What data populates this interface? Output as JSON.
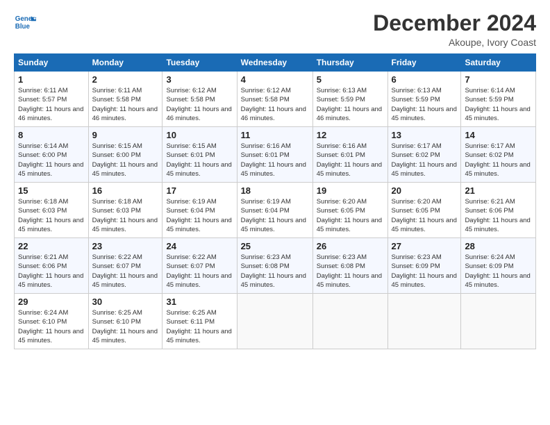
{
  "logo": {
    "line1": "General",
    "line2": "Blue"
  },
  "title": "December 2024",
  "subtitle": "Akoupe, Ivory Coast",
  "days_of_week": [
    "Sunday",
    "Monday",
    "Tuesday",
    "Wednesday",
    "Thursday",
    "Friday",
    "Saturday"
  ],
  "weeks": [
    [
      {
        "day": "1",
        "sunrise": "6:11 AM",
        "sunset": "5:57 PM",
        "daylight": "11 hours and 46 minutes."
      },
      {
        "day": "2",
        "sunrise": "6:11 AM",
        "sunset": "5:58 PM",
        "daylight": "11 hours and 46 minutes."
      },
      {
        "day": "3",
        "sunrise": "6:12 AM",
        "sunset": "5:58 PM",
        "daylight": "11 hours and 46 minutes."
      },
      {
        "day": "4",
        "sunrise": "6:12 AM",
        "sunset": "5:58 PM",
        "daylight": "11 hours and 46 minutes."
      },
      {
        "day": "5",
        "sunrise": "6:13 AM",
        "sunset": "5:59 PM",
        "daylight": "11 hours and 46 minutes."
      },
      {
        "day": "6",
        "sunrise": "6:13 AM",
        "sunset": "5:59 PM",
        "daylight": "11 hours and 45 minutes."
      },
      {
        "day": "7",
        "sunrise": "6:14 AM",
        "sunset": "5:59 PM",
        "daylight": "11 hours and 45 minutes."
      }
    ],
    [
      {
        "day": "8",
        "sunrise": "6:14 AM",
        "sunset": "6:00 PM",
        "daylight": "11 hours and 45 minutes."
      },
      {
        "day": "9",
        "sunrise": "6:15 AM",
        "sunset": "6:00 PM",
        "daylight": "11 hours and 45 minutes."
      },
      {
        "day": "10",
        "sunrise": "6:15 AM",
        "sunset": "6:01 PM",
        "daylight": "11 hours and 45 minutes."
      },
      {
        "day": "11",
        "sunrise": "6:16 AM",
        "sunset": "6:01 PM",
        "daylight": "11 hours and 45 minutes."
      },
      {
        "day": "12",
        "sunrise": "6:16 AM",
        "sunset": "6:01 PM",
        "daylight": "11 hours and 45 minutes."
      },
      {
        "day": "13",
        "sunrise": "6:17 AM",
        "sunset": "6:02 PM",
        "daylight": "11 hours and 45 minutes."
      },
      {
        "day": "14",
        "sunrise": "6:17 AM",
        "sunset": "6:02 PM",
        "daylight": "11 hours and 45 minutes."
      }
    ],
    [
      {
        "day": "15",
        "sunrise": "6:18 AM",
        "sunset": "6:03 PM",
        "daylight": "11 hours and 45 minutes."
      },
      {
        "day": "16",
        "sunrise": "6:18 AM",
        "sunset": "6:03 PM",
        "daylight": "11 hours and 45 minutes."
      },
      {
        "day": "17",
        "sunrise": "6:19 AM",
        "sunset": "6:04 PM",
        "daylight": "11 hours and 45 minutes."
      },
      {
        "day": "18",
        "sunrise": "6:19 AM",
        "sunset": "6:04 PM",
        "daylight": "11 hours and 45 minutes."
      },
      {
        "day": "19",
        "sunrise": "6:20 AM",
        "sunset": "6:05 PM",
        "daylight": "11 hours and 45 minutes."
      },
      {
        "day": "20",
        "sunrise": "6:20 AM",
        "sunset": "6:05 PM",
        "daylight": "11 hours and 45 minutes."
      },
      {
        "day": "21",
        "sunrise": "6:21 AM",
        "sunset": "6:06 PM",
        "daylight": "11 hours and 45 minutes."
      }
    ],
    [
      {
        "day": "22",
        "sunrise": "6:21 AM",
        "sunset": "6:06 PM",
        "daylight": "11 hours and 45 minutes."
      },
      {
        "day": "23",
        "sunrise": "6:22 AM",
        "sunset": "6:07 PM",
        "daylight": "11 hours and 45 minutes."
      },
      {
        "day": "24",
        "sunrise": "6:22 AM",
        "sunset": "6:07 PM",
        "daylight": "11 hours and 45 minutes."
      },
      {
        "day": "25",
        "sunrise": "6:23 AM",
        "sunset": "6:08 PM",
        "daylight": "11 hours and 45 minutes."
      },
      {
        "day": "26",
        "sunrise": "6:23 AM",
        "sunset": "6:08 PM",
        "daylight": "11 hours and 45 minutes."
      },
      {
        "day": "27",
        "sunrise": "6:23 AM",
        "sunset": "6:09 PM",
        "daylight": "11 hours and 45 minutes."
      },
      {
        "day": "28",
        "sunrise": "6:24 AM",
        "sunset": "6:09 PM",
        "daylight": "11 hours and 45 minutes."
      }
    ],
    [
      {
        "day": "29",
        "sunrise": "6:24 AM",
        "sunset": "6:10 PM",
        "daylight": "11 hours and 45 minutes."
      },
      {
        "day": "30",
        "sunrise": "6:25 AM",
        "sunset": "6:10 PM",
        "daylight": "11 hours and 45 minutes."
      },
      {
        "day": "31",
        "sunrise": "6:25 AM",
        "sunset": "6:11 PM",
        "daylight": "11 hours and 45 minutes."
      },
      null,
      null,
      null,
      null
    ]
  ]
}
